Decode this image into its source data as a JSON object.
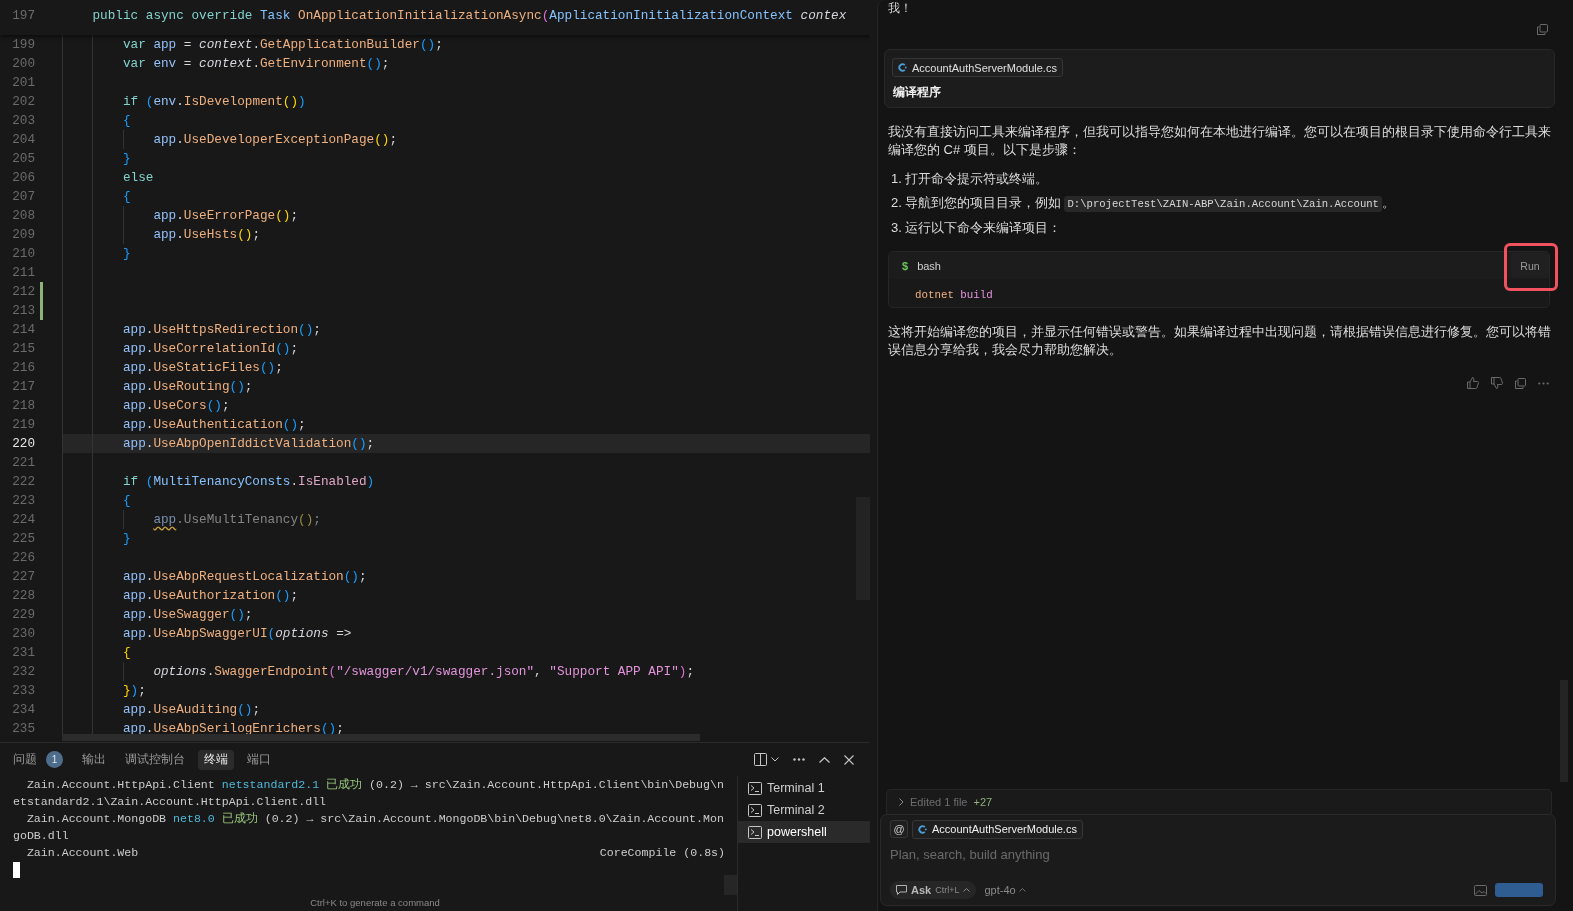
{
  "editor": {
    "sticky_line": {
      "number": "197",
      "tokens": [
        {
          "text": "    public async override",
          "kind": "kw"
        },
        {
          "text": " Task ",
          "kind": "type"
        },
        {
          "text": "OnApplicationInitializationAsync",
          "kind": "method"
        },
        {
          "text": "(",
          "kind": "br3"
        },
        {
          "text": "ApplicationInitializationContext ",
          "kind": "type"
        },
        {
          "text": "contex",
          "kind": "param"
        }
      ]
    },
    "lines": [
      {
        "number": "199",
        "current": false,
        "added": false,
        "tokens": [
          {
            "text": "        var",
            "kind": "kw"
          },
          {
            "text": " app",
            "kind": "var"
          },
          {
            "text": " = ",
            "kind": "plain"
          },
          {
            "text": "context",
            "kind": "param"
          },
          {
            "text": ".",
            "kind": "plain"
          },
          {
            "text": "GetApplicationBuilder",
            "kind": "method"
          },
          {
            "text": "()",
            "kind": "br1"
          },
          {
            "text": ";",
            "kind": "plain"
          }
        ]
      },
      {
        "number": "200",
        "current": false,
        "added": false,
        "tokens": [
          {
            "text": "        var",
            "kind": "kw"
          },
          {
            "text": " env",
            "kind": "var"
          },
          {
            "text": " = ",
            "kind": "plain"
          },
          {
            "text": "context",
            "kind": "param"
          },
          {
            "text": ".",
            "kind": "plain"
          },
          {
            "text": "GetEnvironment",
            "kind": "method"
          },
          {
            "text": "()",
            "kind": "br1"
          },
          {
            "text": ";",
            "kind": "plain"
          }
        ]
      },
      {
        "number": "201",
        "current": false,
        "added": false
      },
      {
        "number": "202",
        "current": false,
        "added": false,
        "tokens": [
          {
            "text": "        if",
            "kind": "kw"
          },
          {
            "text": " (",
            "kind": "br1"
          },
          {
            "text": "env",
            "kind": "var"
          },
          {
            "text": ".",
            "kind": "plain"
          },
          {
            "text": "IsDevelopment",
            "kind": "method"
          },
          {
            "text": "()",
            "kind": "br2"
          },
          {
            "text": ")",
            "kind": "br1"
          }
        ]
      },
      {
        "number": "203",
        "current": false,
        "added": false,
        "tokens": [
          {
            "text": "        {",
            "kind": "br1"
          }
        ]
      },
      {
        "number": "204",
        "current": false,
        "added": false,
        "tokens": [
          {
            "text": "            app",
            "kind": "var"
          },
          {
            "text": ".",
            "kind": "plain"
          },
          {
            "text": "UseDeveloperExceptionPage",
            "kind": "method"
          },
          {
            "text": "()",
            "kind": "br2"
          },
          {
            "text": ";",
            "kind": "plain"
          }
        ]
      },
      {
        "number": "205",
        "current": false,
        "added": false,
        "tokens": [
          {
            "text": "        }",
            "kind": "br1"
          }
        ]
      },
      {
        "number": "206",
        "current": false,
        "added": false,
        "tokens": [
          {
            "text": "        else",
            "kind": "kw"
          }
        ]
      },
      {
        "number": "207",
        "current": false,
        "added": false,
        "tokens": [
          {
            "text": "        {",
            "kind": "br1"
          }
        ]
      },
      {
        "number": "208",
        "current": false,
        "added": false,
        "tokens": [
          {
            "text": "            app",
            "kind": "var"
          },
          {
            "text": ".",
            "kind": "plain"
          },
          {
            "text": "UseErrorPage",
            "kind": "method"
          },
          {
            "text": "()",
            "kind": "br2"
          },
          {
            "text": ";",
            "kind": "plain"
          }
        ]
      },
      {
        "number": "209",
        "current": false,
        "added": false,
        "tokens": [
          {
            "text": "            app",
            "kind": "var"
          },
          {
            "text": ".",
            "kind": "plain"
          },
          {
            "text": "UseHsts",
            "kind": "method"
          },
          {
            "text": "()",
            "kind": "br2"
          },
          {
            "text": ";",
            "kind": "plain"
          }
        ]
      },
      {
        "number": "210",
        "current": false,
        "added": false,
        "tokens": [
          {
            "text": "        }",
            "kind": "br1"
          }
        ]
      },
      {
        "number": "211",
        "current": false,
        "added": false
      },
      {
        "number": "212",
        "current": false,
        "added": true
      },
      {
        "number": "213",
        "current": false,
        "added": true
      },
      {
        "number": "214",
        "current": false,
        "added": false,
        "tokens": [
          {
            "text": "        app",
            "kind": "var"
          },
          {
            "text": ".",
            "kind": "plain"
          },
          {
            "text": "UseHttpsRedirection",
            "kind": "method"
          },
          {
            "text": "()",
            "kind": "br1"
          },
          {
            "text": ";",
            "kind": "plain"
          }
        ]
      },
      {
        "number": "215",
        "current": false,
        "added": false,
        "tokens": [
          {
            "text": "        app",
            "kind": "var"
          },
          {
            "text": ".",
            "kind": "plain"
          },
          {
            "text": "UseCorrelationId",
            "kind": "method"
          },
          {
            "text": "()",
            "kind": "br1"
          },
          {
            "text": ";",
            "kind": "plain"
          }
        ]
      },
      {
        "number": "216",
        "current": false,
        "added": false,
        "tokens": [
          {
            "text": "        app",
            "kind": "var"
          },
          {
            "text": ".",
            "kind": "plain"
          },
          {
            "text": "UseStaticFiles",
            "kind": "method"
          },
          {
            "text": "()",
            "kind": "br1"
          },
          {
            "text": ";",
            "kind": "plain"
          }
        ]
      },
      {
        "number": "217",
        "current": false,
        "added": false,
        "tokens": [
          {
            "text": "        app",
            "kind": "var"
          },
          {
            "text": ".",
            "kind": "plain"
          },
          {
            "text": "UseRouting",
            "kind": "method"
          },
          {
            "text": "()",
            "kind": "br1"
          },
          {
            "text": ";",
            "kind": "plain"
          }
        ]
      },
      {
        "number": "218",
        "current": false,
        "added": false,
        "tokens": [
          {
            "text": "        app",
            "kind": "var"
          },
          {
            "text": ".",
            "kind": "plain"
          },
          {
            "text": "UseCors",
            "kind": "method"
          },
          {
            "text": "()",
            "kind": "br1"
          },
          {
            "text": ";",
            "kind": "plain"
          }
        ]
      },
      {
        "number": "219",
        "current": false,
        "added": false,
        "tokens": [
          {
            "text": "        app",
            "kind": "var"
          },
          {
            "text": ".",
            "kind": "plain"
          },
          {
            "text": "UseAuthentication",
            "kind": "method"
          },
          {
            "text": "()",
            "kind": "br1"
          },
          {
            "text": ";",
            "kind": "plain"
          }
        ]
      },
      {
        "number": "220",
        "current": true,
        "added": false,
        "tokens": [
          {
            "text": "        app",
            "kind": "var"
          },
          {
            "text": ".",
            "kind": "plain"
          },
          {
            "text": "UseAbpOpenIddictValidation",
            "kind": "method"
          },
          {
            "text": "()",
            "kind": "br1"
          },
          {
            "text": ";",
            "kind": "plain"
          }
        ]
      },
      {
        "number": "221",
        "current": false,
        "added": false
      },
      {
        "number": "222",
        "current": false,
        "added": false,
        "tokens": [
          {
            "text": "        if",
            "kind": "kw"
          },
          {
            "text": " (",
            "kind": "br1"
          },
          {
            "text": "MultiTenancyConsts",
            "kind": "type"
          },
          {
            "text": ".",
            "kind": "plain"
          },
          {
            "text": "IsEnabled",
            "kind": "prop"
          },
          {
            "text": ")",
            "kind": "br1"
          }
        ]
      },
      {
        "number": "223",
        "current": false,
        "added": false,
        "tokens": [
          {
            "text": "        {",
            "kind": "br1"
          }
        ]
      },
      {
        "number": "224",
        "current": false,
        "added": false,
        "tokens": [
          {
            "text": "            app",
            "kind": "warn"
          },
          {
            "text": ".UseMultiTenancy",
            "kind": "dim"
          },
          {
            "text": "()",
            "kind": "dimbr"
          },
          {
            "text": ";",
            "kind": "dim"
          }
        ]
      },
      {
        "number": "225",
        "current": false,
        "added": false,
        "tokens": [
          {
            "text": "        }",
            "kind": "br1"
          }
        ]
      },
      {
        "number": "226",
        "current": false,
        "added": false
      },
      {
        "number": "227",
        "current": false,
        "added": false,
        "tokens": [
          {
            "text": "        app",
            "kind": "var"
          },
          {
            "text": ".",
            "kind": "plain"
          },
          {
            "text": "UseAbpRequestLocalization",
            "kind": "method"
          },
          {
            "text": "()",
            "kind": "br1"
          },
          {
            "text": ";",
            "kind": "plain"
          }
        ]
      },
      {
        "number": "228",
        "current": false,
        "added": false,
        "tokens": [
          {
            "text": "        app",
            "kind": "var"
          },
          {
            "text": ".",
            "kind": "plain"
          },
          {
            "text": "UseAuthorization",
            "kind": "method"
          },
          {
            "text": "()",
            "kind": "br1"
          },
          {
            "text": ";",
            "kind": "plain"
          }
        ]
      },
      {
        "number": "229",
        "current": false,
        "added": false,
        "tokens": [
          {
            "text": "        app",
            "kind": "var"
          },
          {
            "text": ".",
            "kind": "plain"
          },
          {
            "text": "UseSwagger",
            "kind": "method"
          },
          {
            "text": "()",
            "kind": "br1"
          },
          {
            "text": ";",
            "kind": "plain"
          }
        ]
      },
      {
        "number": "230",
        "current": false,
        "added": false,
        "tokens": [
          {
            "text": "        app",
            "kind": "var"
          },
          {
            "text": ".",
            "kind": "plain"
          },
          {
            "text": "UseAbpSwaggerUI",
            "kind": "method"
          },
          {
            "text": "(",
            "kind": "br1"
          },
          {
            "text": "options",
            "kind": "param"
          },
          {
            "text": " =>",
            "kind": "plain"
          }
        ]
      },
      {
        "number": "231",
        "current": false,
        "added": false,
        "tokens": [
          {
            "text": "        {",
            "kind": "br2"
          }
        ]
      },
      {
        "number": "232",
        "current": false,
        "added": false,
        "tokens": [
          {
            "text": "            options",
            "kind": "param"
          },
          {
            "text": ".",
            "kind": "plain"
          },
          {
            "text": "SwaggerEndpoint",
            "kind": "method"
          },
          {
            "text": "(",
            "kind": "br3"
          },
          {
            "text": "\"/swagger/v1/swagger.json\"",
            "kind": "str"
          },
          {
            "text": ", ",
            "kind": "plain"
          },
          {
            "text": "\"Support APP API\"",
            "kind": "str"
          },
          {
            "text": ")",
            "kind": "br3"
          },
          {
            "text": ";",
            "kind": "plain"
          }
        ]
      },
      {
        "number": "233",
        "current": false,
        "added": false,
        "tokens": [
          {
            "text": "        }",
            "kind": "br2"
          },
          {
            "text": ")",
            "kind": "br1"
          },
          {
            "text": ";",
            "kind": "plain"
          }
        ]
      },
      {
        "number": "234",
        "current": false,
        "added": false,
        "tokens": [
          {
            "text": "        app",
            "kind": "var"
          },
          {
            "text": ".",
            "kind": "plain"
          },
          {
            "text": "UseAuditing",
            "kind": "method"
          },
          {
            "text": "()",
            "kind": "br1"
          },
          {
            "text": ";",
            "kind": "plain"
          }
        ]
      },
      {
        "number": "235",
        "current": false,
        "added": false,
        "tokens": [
          {
            "text": "        app",
            "kind": "var"
          },
          {
            "text": ".",
            "kind": "plain"
          },
          {
            "text": "UseAbpSerilogEnrichers",
            "kind": "method"
          },
          {
            "text": "()",
            "kind": "br1"
          },
          {
            "text": ";",
            "kind": "plain"
          }
        ]
      }
    ]
  },
  "panel": {
    "tabs": [
      {
        "label": "问题",
        "badge": "1",
        "selected": false
      },
      {
        "label": "输出",
        "selected": false
      },
      {
        "label": "调试控制台",
        "selected": false
      },
      {
        "label": "终端",
        "selected": true
      },
      {
        "label": "端口",
        "selected": false
      }
    ],
    "terminal": {
      "lines": [
        {
          "segments": [
            {
              "text": "  Zain.Account.HttpApi.Client ",
              "kind": "plain"
            },
            {
              "text": "netstandard2.1 ",
              "kind": "framework"
            },
            {
              "text": "已成功",
              "kind": "success"
            },
            {
              "text": " (0.2) → src\\Zain.Account.HttpApi.Client\\bin\\Debug\\n",
              "kind": "plain"
            }
          ]
        },
        {
          "segments": [
            {
              "text": "etstandard2.1\\Zain.Account.HttpApi.Client.dll",
              "kind": "plain"
            }
          ]
        },
        {
          "segments": [
            {
              "text": "  Zain.Account.MongoDB ",
              "kind": "plain"
            },
            {
              "text": "net8.0 ",
              "kind": "framework"
            },
            {
              "text": "已成功",
              "kind": "success"
            },
            {
              "text": " (0.2) → src\\Zain.Account.MongoDB\\bin\\Debug\\net8.0\\Zain.Account.Mon",
              "kind": "plain"
            }
          ]
        },
        {
          "segments": [
            {
              "text": "goDB.dll",
              "kind": "plain"
            }
          ]
        },
        {
          "segments": [
            {
              "text": "  Zain.Account.Web",
              "kind": "plain"
            }
          ],
          "status": "CoreCompile (0.8s)"
        }
      ],
      "cursor": true,
      "hint": "Ctrl+K to generate a command"
    },
    "sessions": [
      {
        "label": "Terminal 1",
        "selected": false
      },
      {
        "label": "Terminal 2",
        "selected": false
      },
      {
        "label": "powershell",
        "selected": true
      }
    ]
  },
  "chat": {
    "previous_tail": "我！",
    "user_message": {
      "file": "AccountAuthServerModule.cs",
      "text": "编译程序"
    },
    "response": {
      "intro": "我没有直接访问工具来编译程序，但我可以指导您如何在本地进行编译。您可以在项目的根目录下使用命令行工具来编译您的 C# 项目。以下是步骤：",
      "steps": [
        {
          "number": "1.",
          "parts": [
            {
              "kind": "text",
              "text": "打开命令提示符或终端。"
            }
          ]
        },
        {
          "number": "2.",
          "parts": [
            {
              "kind": "text",
              "text": "导航到您的项目目录，例如 "
            },
            {
              "kind": "code",
              "text": "D:\\projectTest\\ZAIN-ABP\\Zain.Account\\Zain.Account"
            },
            {
              "kind": "text",
              "text": "。"
            }
          ]
        },
        {
          "number": "3.",
          "parts": [
            {
              "kind": "text",
              "text": "运行以下命令来编译项目："
            }
          ]
        }
      ],
      "code_block": {
        "prompt": "$",
        "language": "bash",
        "run_label": "Run",
        "run_highlighted": true,
        "tokens": [
          {
            "text": "dotnet ",
            "kind": "command"
          },
          {
            "text": "build",
            "kind": "arg"
          }
        ]
      },
      "outro": "这将开始编译您的项目，并显示任何错误或警告。如果编译过程中出现问题，请根据错误信息进行修复。您可以将错误信息分享给我，我会尽力帮助您解决。"
    },
    "edited": {
      "label": "Edited 1 file",
      "count": "+27",
      "expanded": false
    },
    "composer": {
      "mention": "@",
      "file": "AccountAuthServerModule.cs",
      "placeholder": "Plan, search, build anything",
      "mode": "Ask",
      "shortcut": "Ctrl+L",
      "model": "gpt-4o"
    }
  }
}
